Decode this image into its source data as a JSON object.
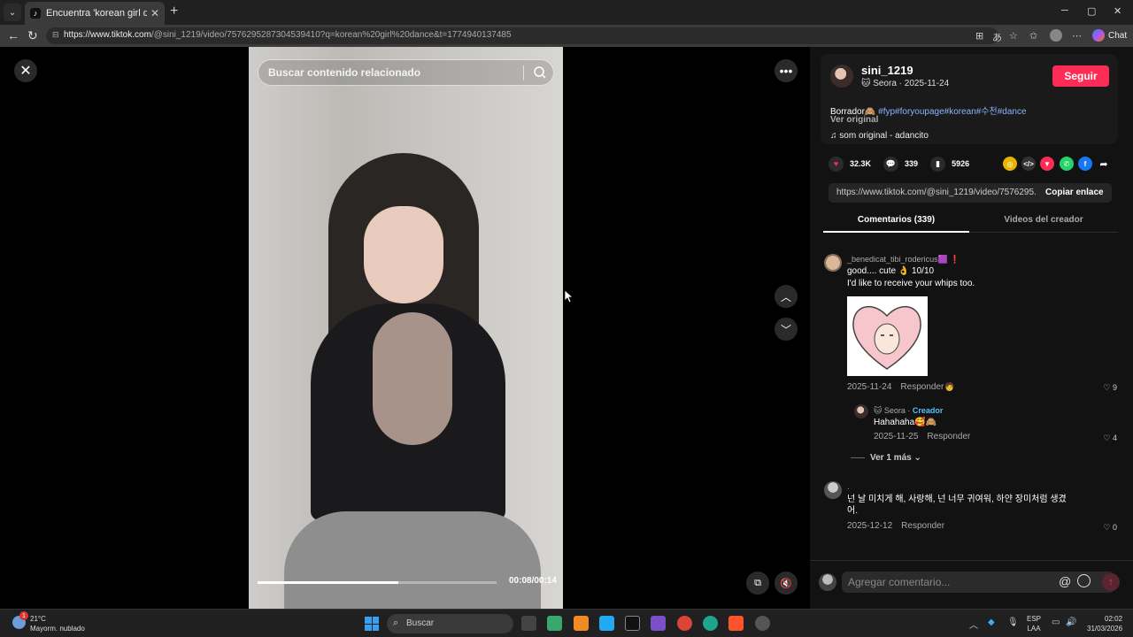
{
  "browser": {
    "tab_title": "Encuentra 'korean girl dance' en T",
    "tab_close": "✕",
    "new_tab": "+",
    "url_host": "https://www.tiktok.com",
    "url_path": "/@sini_1219/video/7576295287304539410?q=korean%20girl%20dance&t=1774940137485",
    "chat_label": "Chat",
    "win_min": "─",
    "win_max": "▢",
    "win_close": "✕"
  },
  "video": {
    "search_placeholder": "Buscar contenido relacionado",
    "progress": 0.59,
    "time": "00:08/00:14"
  },
  "author": {
    "username": "sini_1219",
    "display_line": "🐱 Seora · 2025-11-24",
    "follow_label": "Seguir",
    "description_text": "Borrador🙈 ",
    "description_tags": "#fyp#foryoupage#korean#수천#dance",
    "see_original": "Ver original",
    "music": "♫  som original - adancito"
  },
  "stats": {
    "likes": "32.3K",
    "comments": "339",
    "saves": "5926"
  },
  "link": {
    "url": "https://www.tiktok.com/@sini_1219/video/7576295...",
    "copy_label": "Copiar enlace"
  },
  "tabs": {
    "comments": "Comentarios (339)",
    "creator_videos": "Videos del creador"
  },
  "comments": [
    {
      "name": "_benedicat_tibi_rodericus🟪 ❗",
      "line1": "good.... cute 👌 10/10",
      "line2": "I'd like to receive your whips too.",
      "date": "2025-11-24",
      "reply": "Responder",
      "likes": "9"
    },
    {
      "name": "🐱 Seora · ",
      "creator_tag": "Creador",
      "line1": "Hahahaha🥰🙈",
      "date": "2025-11-25",
      "reply": "Responder",
      "likes": "4"
    },
    {
      "name": ".",
      "line1": "넌 날 미치게 해, 사랑해, 넌 너무 귀여워, 하얀 장미처럼 생겼",
      "line2": "어.",
      "date": "2025-12-12",
      "reply": "Responder",
      "likes": "0"
    }
  ],
  "view_more": "Ver 1 más  ⌄",
  "comment_input": {
    "placeholder": "Agregar comentario...",
    "at": "@"
  },
  "taskbar": {
    "temp": "21°C",
    "weather": "Mayorm. nublado",
    "weather_badge": "1",
    "search_label": "Buscar",
    "lang1": "ESP",
    "lang2": "LAA",
    "time": "02:02",
    "date": "31/03/2026"
  }
}
